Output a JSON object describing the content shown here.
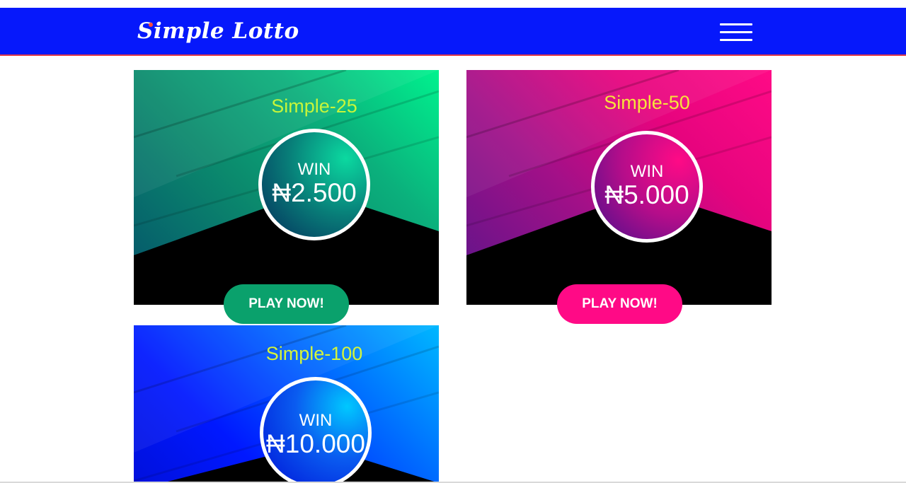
{
  "header": {
    "logo_text": "Simple Lotto",
    "menu_icon": "hamburger-menu-icon",
    "background_color": "#0618fb"
  },
  "games": [
    {
      "title": "Simple-25",
      "win_label": "WIN",
      "prize": "₦2.500",
      "button_label": "PLAY NOW!",
      "title_color": "#c6f53a",
      "button_color": "#0aa16c"
    },
    {
      "title": "Simple-50",
      "win_label": "WIN",
      "prize": "₦5.000",
      "button_label": "PLAY NOW!",
      "title_color": "#f6e43b",
      "button_color": "#ff0a86"
    },
    {
      "title": "Simple-100",
      "win_label": "WIN",
      "prize": "₦10.000",
      "title_color": "#d4f53a"
    }
  ]
}
